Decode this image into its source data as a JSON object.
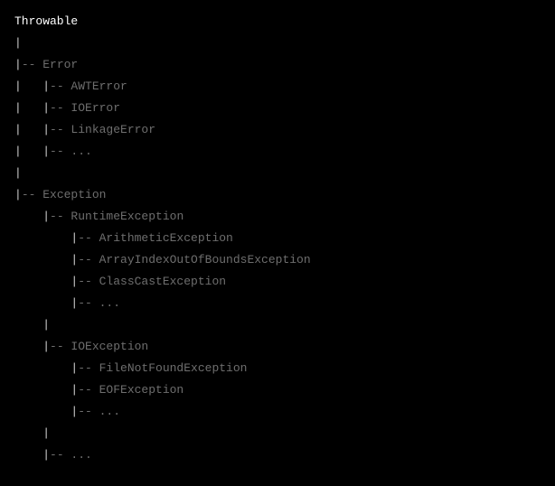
{
  "lines": [
    {
      "segments": [
        {
          "class": "white",
          "text": "Throwable"
        }
      ]
    },
    {
      "segments": [
        {
          "class": "gray-pipe",
          "text": "|"
        }
      ]
    },
    {
      "segments": [
        {
          "class": "gray-pipe",
          "text": "|"
        },
        {
          "class": "dark-gray",
          "text": "-- Error"
        }
      ]
    },
    {
      "segments": [
        {
          "class": "gray-pipe",
          "text": "|   |"
        },
        {
          "class": "dark-gray",
          "text": "-- AWTError"
        }
      ]
    },
    {
      "segments": [
        {
          "class": "gray-pipe",
          "text": "|   |"
        },
        {
          "class": "dark-gray",
          "text": "-- IOError"
        }
      ]
    },
    {
      "segments": [
        {
          "class": "gray-pipe",
          "text": "|   |"
        },
        {
          "class": "dark-gray",
          "text": "-- LinkageError"
        }
      ]
    },
    {
      "segments": [
        {
          "class": "gray-pipe",
          "text": "|   |"
        },
        {
          "class": "dark-gray",
          "text": "-- ..."
        }
      ]
    },
    {
      "segments": [
        {
          "class": "gray-pipe",
          "text": "|"
        }
      ]
    },
    {
      "segments": [
        {
          "class": "gray-pipe",
          "text": "|"
        },
        {
          "class": "dark-gray",
          "text": "-- Exception"
        }
      ]
    },
    {
      "segments": [
        {
          "class": "gray-pipe",
          "text": "    |"
        },
        {
          "class": "dark-gray",
          "text": "-- RuntimeException"
        }
      ]
    },
    {
      "segments": [
        {
          "class": "gray-pipe",
          "text": "        |"
        },
        {
          "class": "dark-gray",
          "text": "-- ArithmeticException"
        }
      ]
    },
    {
      "segments": [
        {
          "class": "gray-pipe",
          "text": "        |"
        },
        {
          "class": "dark-gray",
          "text": "-- ArrayIndexOutOfBoundsException"
        }
      ]
    },
    {
      "segments": [
        {
          "class": "gray-pipe",
          "text": "        |"
        },
        {
          "class": "dark-gray",
          "text": "-- ClassCastException"
        }
      ]
    },
    {
      "segments": [
        {
          "class": "gray-pipe",
          "text": "        |"
        },
        {
          "class": "dark-gray",
          "text": "-- ..."
        }
      ]
    },
    {
      "segments": [
        {
          "class": "gray-pipe",
          "text": "    |"
        }
      ]
    },
    {
      "segments": [
        {
          "class": "gray-pipe",
          "text": "    |"
        },
        {
          "class": "dark-gray",
          "text": "-- IOException"
        }
      ]
    },
    {
      "segments": [
        {
          "class": "gray-pipe",
          "text": "        |"
        },
        {
          "class": "dark-gray",
          "text": "-- FileNotFoundException"
        }
      ]
    },
    {
      "segments": [
        {
          "class": "gray-pipe",
          "text": "        |"
        },
        {
          "class": "dark-gray",
          "text": "-- EOFException"
        }
      ]
    },
    {
      "segments": [
        {
          "class": "gray-pipe",
          "text": "        |"
        },
        {
          "class": "dark-gray",
          "text": "-- ..."
        }
      ]
    },
    {
      "segments": [
        {
          "class": "gray-pipe",
          "text": "    |"
        }
      ]
    },
    {
      "segments": [
        {
          "class": "gray-pipe",
          "text": "    |"
        },
        {
          "class": "dark-gray",
          "text": "-- ..."
        }
      ]
    }
  ]
}
